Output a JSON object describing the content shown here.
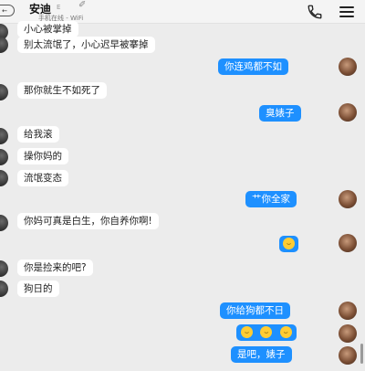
{
  "header": {
    "back_label": "←",
    "contact_name": "安迪",
    "vip_mark": "E",
    "edit_mark": "✐",
    "status": "手机在线 - WiFi"
  },
  "messages": [
    {
      "side": "left",
      "text": "小心被掌掉"
    },
    {
      "side": "left",
      "text": "别太流氓了，小心迟早被搴掉"
    },
    {
      "side": "right",
      "text": "你连鸡都不如"
    },
    {
      "side": "left",
      "text": "那你就生不如死了"
    },
    {
      "side": "right",
      "text": "臭婊子"
    },
    {
      "side": "left",
      "text": "给我滚"
    },
    {
      "side": "left",
      "text": "操你妈的"
    },
    {
      "side": "left",
      "text": "流氓变态"
    },
    {
      "side": "right",
      "text": "艹你全家"
    },
    {
      "side": "left",
      "text": "你妈可真是白生，你自养你啊!"
    },
    {
      "side": "right",
      "emojis": [
        "grin-emoji"
      ]
    },
    {
      "side": "left",
      "text": "你是捡来的吧?"
    },
    {
      "side": "left",
      "text": "狗日的"
    },
    {
      "side": "right",
      "text": "你给狗都不日"
    },
    {
      "side": "right",
      "emojis": [
        "laugh-cry-emoji",
        "laugh-cry-emoji",
        "laugh-cry-emoji"
      ]
    },
    {
      "side": "right",
      "text": "是吧，婊子"
    }
  ],
  "colors": {
    "background": "#ececec",
    "sent_bubble": "#1e90ff",
    "received_bubble": "#ffffff"
  }
}
